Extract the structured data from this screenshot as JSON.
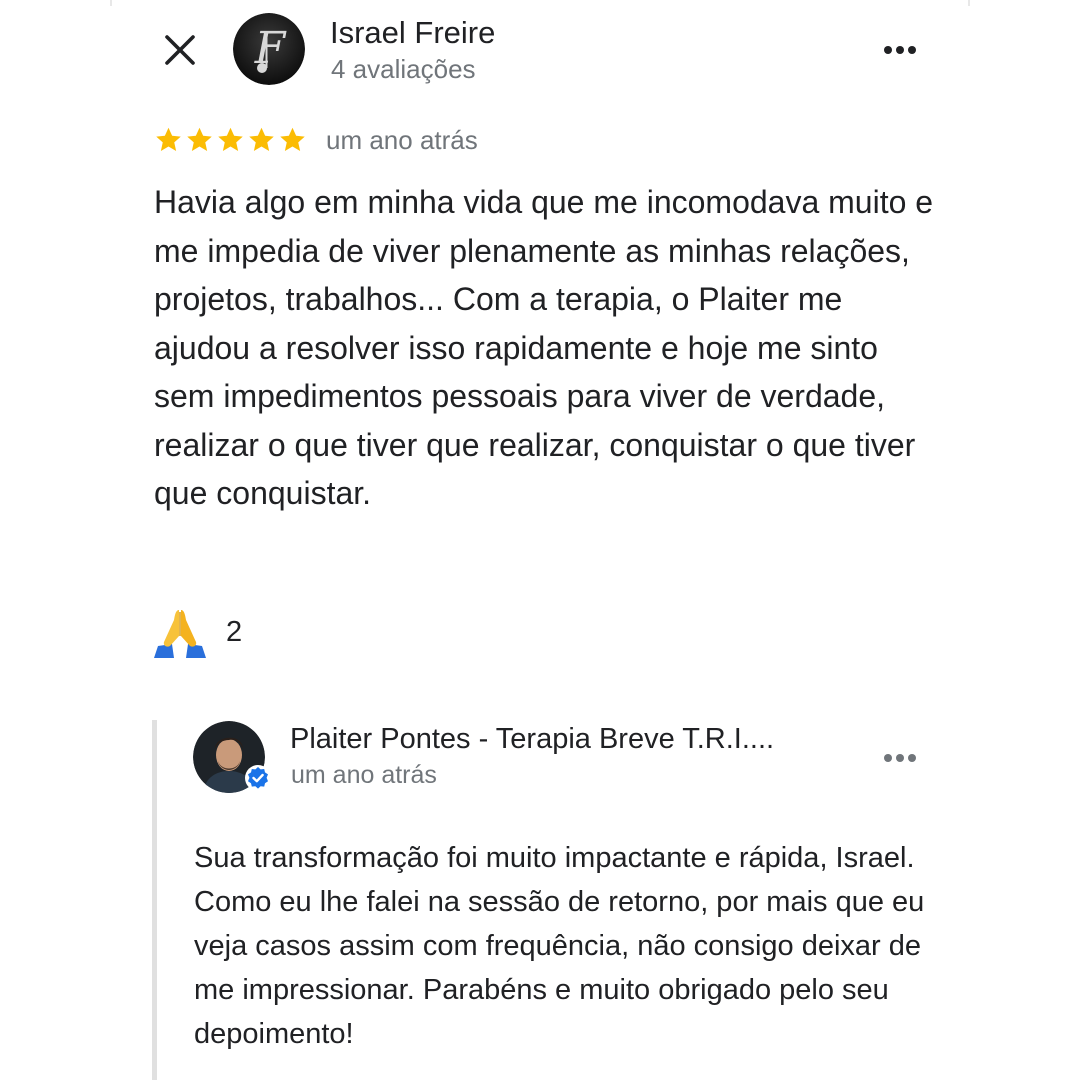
{
  "review": {
    "author_name": "Israel Freire",
    "author_review_count": "4 avaliações",
    "avatar_icon": "letter-f-music-logo",
    "rating": 5,
    "rating_max": 5,
    "time": "um ano atrás",
    "text": "Havia algo em minha vida que me incomodava muito e me impedia de viver plenamente as minhas relações, projetos, trabalhos... Com a terapia, o Plaiter me ajudou a resolver isso rapidamente e hoje me sinto sem impedimentos pessoais para viver de verdade, realizar o que tiver que realizar, conquistar o que tiver que conquistar.",
    "reaction": {
      "icon": "folded-hands-emoji",
      "emoji": "🙏",
      "count": "2"
    }
  },
  "reply": {
    "owner_name": "Plaiter Pontes - Terapia Breve T.R.I....",
    "time": "um ano atrás",
    "verified_icon": "verified-check-icon",
    "text": "Sua transformação foi muito impactante e rápida, Israel. Como eu lhe falei na sessão de retorno, por mais que eu veja casos assim com frequência, não consigo deixar de me impressionar. Parabéns e muito obrigado pelo seu depoimento!"
  },
  "icons": {
    "close": "close-icon",
    "more": "more-horizontal-icon"
  },
  "colors": {
    "star": "#fbbc04",
    "text_primary": "#202124",
    "text_secondary": "#70757a",
    "verified": "#1a73e8",
    "reply_bar": "#e0e0e0"
  }
}
